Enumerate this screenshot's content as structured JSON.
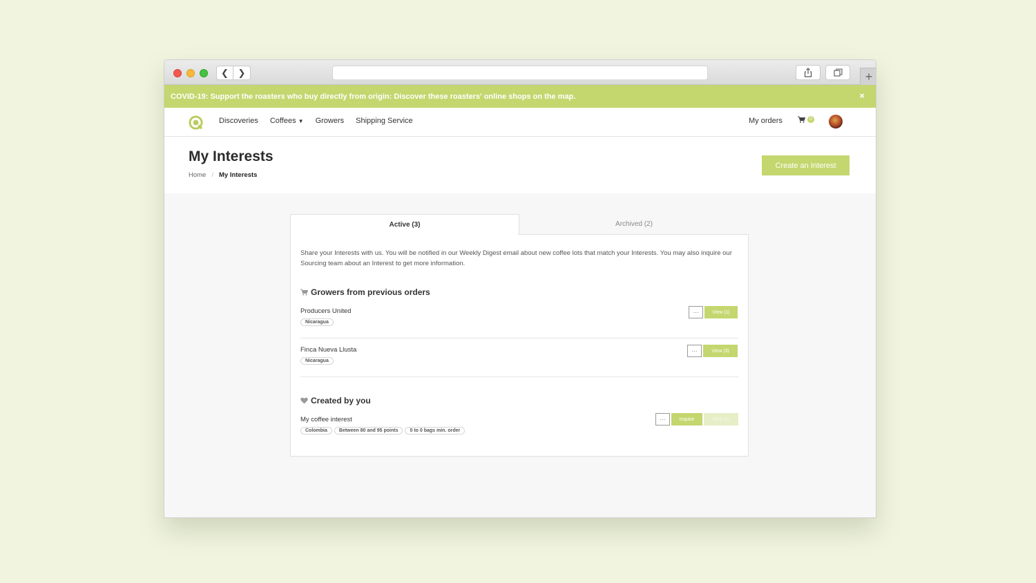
{
  "browser": {
    "url": ""
  },
  "banner": {
    "text": "COVID-19: Support the roasters who buy directly from origin: Discover these roasters' online shops on the map.",
    "close": "×"
  },
  "nav": {
    "links": [
      "Discoveries",
      "Coffees",
      "Growers",
      "Shipping Service"
    ],
    "my_orders": "My orders",
    "cart_count": "0"
  },
  "page": {
    "title": "My Interests",
    "breadcrumb": [
      "Home",
      "My Interests"
    ],
    "create_button": "Create an Interest"
  },
  "tabs": {
    "active": "Active (3)",
    "archived": "Archived (2)"
  },
  "intro": "Share your Interests with us. You will be notified in our Weekly Digest email about new coffee lots that match your Interests. You may also inquire our Sourcing team about an Interest to get more information.",
  "growers_section": {
    "heading": "Growers from previous orders",
    "items": [
      {
        "name": "Producers United",
        "tags": [
          "Nicaragua"
        ],
        "more": "···",
        "view": "View (1)"
      },
      {
        "name": "Finca Nueva Llusta",
        "tags": [
          "Nicaragua"
        ],
        "more": "···",
        "view": "View (3)"
      }
    ]
  },
  "created_section": {
    "heading": "Created by you",
    "items": [
      {
        "name": "My coffee interest",
        "tags": [
          "Colombia",
          "Between 80 and 95 points",
          "0 to 0 bags min. order"
        ],
        "more": "···",
        "inquire": "Inquire",
        "view": "View (0)"
      }
    ]
  },
  "colors": {
    "accent": "#c4d66e",
    "page_bg": "#f1f5df"
  }
}
